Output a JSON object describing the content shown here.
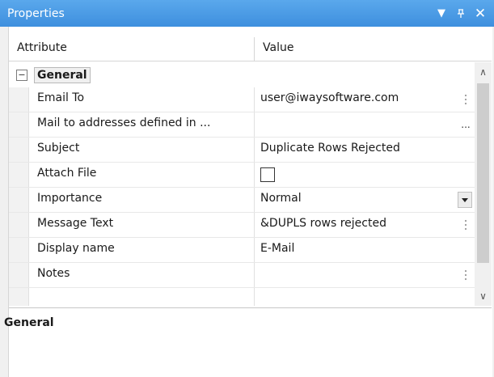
{
  "window": {
    "title": "Properties",
    "dropdown_glyph": "▼",
    "pin_glyph": "ᵖ",
    "close_glyph": "✕"
  },
  "header": {
    "attribute": "Attribute",
    "value": "Value"
  },
  "group": {
    "toggle": "−",
    "label": "General"
  },
  "rows": [
    {
      "attribute": "Email To",
      "value": "user@iwaysoftware.com",
      "editor": "dots"
    },
    {
      "attribute": "Mail to addresses defined in ...",
      "value": "",
      "editor": "ellipsis",
      "ellipsis": "..."
    },
    {
      "attribute": "Subject",
      "value": "Duplicate Rows Rejected",
      "editor": "none"
    },
    {
      "attribute": "Attach File",
      "value": "",
      "editor": "checkbox",
      "checked": false
    },
    {
      "attribute": "Importance",
      "value": "Normal",
      "editor": "dropdown"
    },
    {
      "attribute": "Message Text",
      "value": "&DUPLS rows rejected",
      "editor": "dots"
    },
    {
      "attribute": "Display name",
      "value": "E-Mail",
      "editor": "none"
    },
    {
      "attribute": "Notes",
      "value": "",
      "editor": "dots"
    }
  ],
  "scrollbar": {
    "up": "∧",
    "down": "∨"
  },
  "description": {
    "title": "General"
  },
  "colors": {
    "titlebar": "#3e8fde",
    "background": "#ffffff"
  }
}
